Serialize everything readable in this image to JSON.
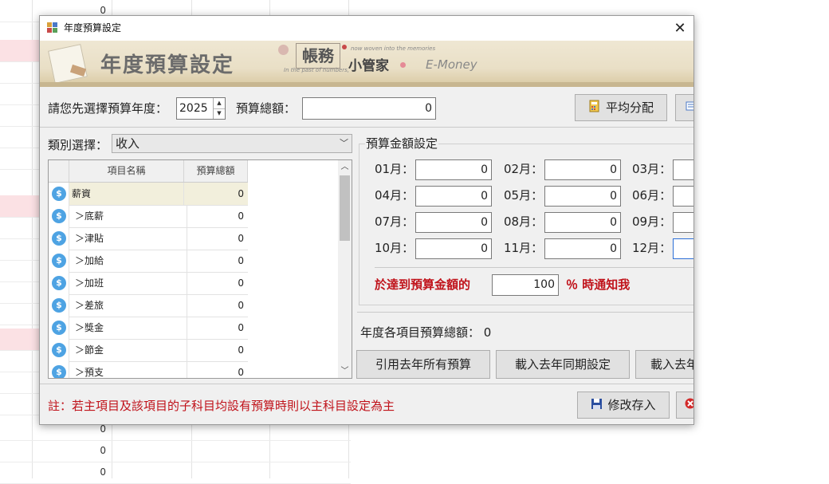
{
  "background_sheet": {
    "visible_values": [
      "0",
      "0",
      "0",
      "0",
      "0"
    ]
  },
  "window": {
    "title": "年度預算設定",
    "close_glyph": "✕"
  },
  "banner": {
    "title": "年度預算設定",
    "box_text": "帳務",
    "app_name": "小管家",
    "brand": "E-Money",
    "tagline_top": "now woven into the memories",
    "tagline_bottom": "In the past of numbers,"
  },
  "year_select": {
    "label": "請您先選擇預算年度：",
    "value": "2025"
  },
  "budget_total": {
    "label": "預算總額：",
    "value": "0"
  },
  "buttons": {
    "average": "平均分配",
    "copy_last_year_all": "引用去年所有預算",
    "load_last_year_period": "載入去年同期設定",
    "load_last_year_partial": "載入去年",
    "save": "修改存入"
  },
  "category": {
    "label": "類別選擇：",
    "value": "收入"
  },
  "grid": {
    "columns": [
      "項目名稱",
      "預算總額"
    ],
    "rows": [
      {
        "name": "薪資",
        "total": "0",
        "child": false
      },
      {
        "name": "＞底薪",
        "total": "0",
        "child": true
      },
      {
        "name": "＞津貼",
        "total": "0",
        "child": true
      },
      {
        "name": "＞加給",
        "total": "0",
        "child": true
      },
      {
        "name": "＞加班",
        "total": "0",
        "child": true
      },
      {
        "name": "＞差旅",
        "total": "0",
        "child": true
      },
      {
        "name": "＞獎金",
        "total": "0",
        "child": true
      },
      {
        "name": "＞節金",
        "total": "0",
        "child": true
      },
      {
        "name": "＞預支",
        "total": "0",
        "child": true
      }
    ]
  },
  "monthly": {
    "group_title": "預算金額設定",
    "months": [
      {
        "label": "01月：",
        "value": "0"
      },
      {
        "label": "02月：",
        "value": "0"
      },
      {
        "label": "03月：",
        "value": ""
      },
      {
        "label": "04月：",
        "value": "0"
      },
      {
        "label": "05月：",
        "value": "0"
      },
      {
        "label": "06月：",
        "value": ""
      },
      {
        "label": "07月：",
        "value": "0"
      },
      {
        "label": "08月：",
        "value": "0"
      },
      {
        "label": "09月：",
        "value": ""
      },
      {
        "label": "10月：",
        "value": "0"
      },
      {
        "label": "11月：",
        "value": "0"
      },
      {
        "label": "12月：",
        "value": ""
      }
    ]
  },
  "alert": {
    "prefix": "於達到預算金額的",
    "percent": "100",
    "suffix": "％ 時通知我"
  },
  "summary": {
    "label": "年度各項目預算總額：",
    "value": "0"
  },
  "note": "註：若主項目及該項目的子科目均設有預算時則以主科目設定為主",
  "colors": {
    "accent_blue": "#2d6fd6",
    "alert_red": "#c0121a",
    "coin_blue": "#4ea3e3",
    "selected_row": "#f2efdc",
    "background_pink": "#fbe1e4"
  }
}
